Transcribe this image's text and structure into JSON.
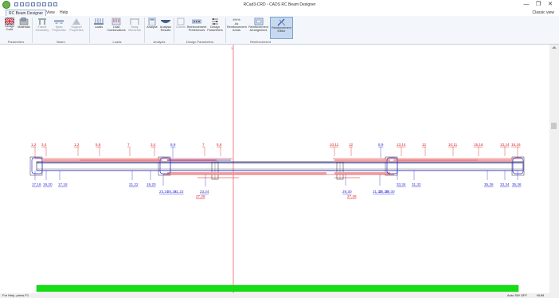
{
  "window": {
    "title": "RCad3-CRD - CADS RC Beam Designer",
    "minimize": "—",
    "maximize": "❐",
    "close": "✕"
  },
  "tabs": [
    {
      "label": "RC Beam Designer",
      "active": true
    },
    {
      "label": "View"
    },
    {
      "label": "Help"
    }
  ],
  "classic_view": "Classic view",
  "ribbon": {
    "buttons": [
      {
        "label": "Design\nCode",
        "icon": "flag-icon"
      },
      {
        "label": "Materials",
        "icon": "materials-icon"
      },
      {
        "label": "Frame\nGeometry",
        "icon": "frame-icon",
        "disabled": true
      },
      {
        "label": "Span\nProperties",
        "icon": "span-icon",
        "disabled": true
      },
      {
        "label": "Support\nProperties",
        "icon": "support-icon",
        "disabled": true
      },
      {
        "label": "Loads",
        "icon": "loads-icon"
      },
      {
        "label": "Load\nCombinations",
        "icon": "load-combinations-icon"
      },
      {
        "label": "Sway\nMoments",
        "icon": "sway-icon",
        "disabled": true
      },
      {
        "label": "Analyse",
        "icon": "analyse-icon"
      },
      {
        "label": "Analysis\nResults",
        "icon": "analysis-results-icon"
      },
      {
        "label": "Covers",
        "icon": "covers-icon",
        "disabled": true
      },
      {
        "label": "Reinforcement\nPreferences",
        "icon": "reinforcement-preferences-icon"
      },
      {
        "label": "Design\nParameters",
        "icon": "design-parameters-icon"
      },
      {
        "label": "Reinforcement\nAreas",
        "icon": "reinforcement-areas-icon"
      },
      {
        "label": "Reinforcement\nArrangement",
        "icon": "reinforcement-arrangement-icon"
      },
      {
        "label": "Reinforcement\nEditor",
        "icon": "reinforcement-editor-icon",
        "selected": true
      }
    ],
    "groups": [
      "Parameters",
      "Beam",
      "Loads",
      "Analysis",
      "Design Parameters",
      "Reinforcement"
    ],
    "areas_glyph": "4%%\nAs"
  },
  "drawing": {
    "centerline_mark": "1",
    "top_labels": [
      "1,2",
      "3,4",
      "1,2",
      "5,6",
      "7",
      "3,4",
      "8,9",
      "7",
      "5,6",
      "10,11",
      "12",
      "8,9",
      "13,14",
      "12",
      "10,11",
      "15,16",
      "13,14",
      "15,16"
    ],
    "bottom_labels_blue": [
      "17,18",
      "19,20",
      "17,18",
      "21,22",
      "19,20",
      "23,24",
      "25,26",
      "21,22",
      "23,24",
      "29,30",
      "31,32",
      "25,26",
      "29,30",
      "33,34",
      "31,32",
      "35,36",
      "33,34",
      "35,36"
    ],
    "bottom_labels_red": [
      "27,28",
      "27,28"
    ]
  },
  "status": {
    "help": "For Help, press F1",
    "auto_sw": "Auto SW OFF",
    "num": "NUM"
  },
  "colors": {
    "ribbon_bg": "#f3f6fb",
    "reinforcement_red": "#e21b1b",
    "stirrup_blue": "#2b2bd6",
    "progress_green": "#13e013",
    "centerline": "#e83030"
  }
}
